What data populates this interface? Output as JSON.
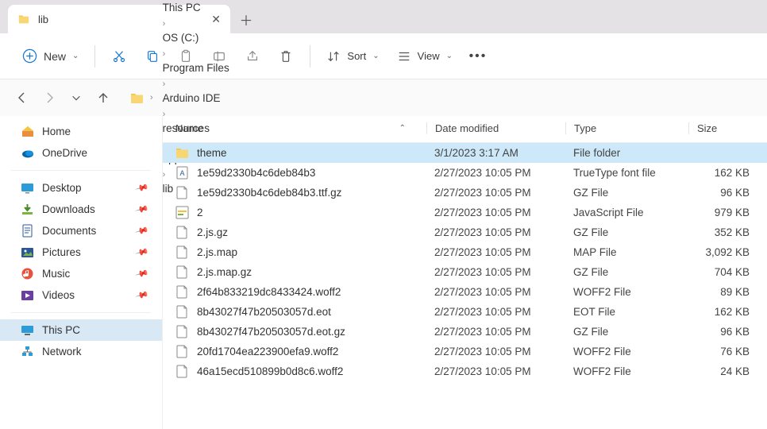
{
  "tab": {
    "title": "lib"
  },
  "toolbar": {
    "new": "New",
    "sort": "Sort",
    "view": "View"
  },
  "breadcrumb": [
    "This PC",
    "OS (C:)",
    "Program Files",
    "Arduino IDE",
    "resources",
    "app",
    "lib"
  ],
  "sidebar": {
    "quick": [
      {
        "label": "Home",
        "icon": "home"
      },
      {
        "label": "OneDrive",
        "icon": "onedrive"
      }
    ],
    "pinned": [
      {
        "label": "Desktop",
        "icon": "desktop"
      },
      {
        "label": "Downloads",
        "icon": "downloads"
      },
      {
        "label": "Documents",
        "icon": "documents"
      },
      {
        "label": "Pictures",
        "icon": "pictures"
      },
      {
        "label": "Music",
        "icon": "music"
      },
      {
        "label": "Videos",
        "icon": "videos"
      }
    ],
    "drives": [
      {
        "label": "This PC",
        "icon": "thispc",
        "selected": true
      },
      {
        "label": "Network",
        "icon": "network"
      }
    ]
  },
  "columns": {
    "name": "Name",
    "date": "Date modified",
    "type": "Type",
    "size": "Size"
  },
  "files": [
    {
      "name": "theme",
      "date": "3/1/2023 3:17 AM",
      "type": "File folder",
      "size": "",
      "icon": "folder",
      "selected": true
    },
    {
      "name": "1e59d2330b4c6deb84b3",
      "date": "2/27/2023 10:05 PM",
      "type": "TrueType font file",
      "size": "162 KB",
      "icon": "font"
    },
    {
      "name": "1e59d2330b4c6deb84b3.ttf.gz",
      "date": "2/27/2023 10:05 PM",
      "type": "GZ File",
      "size": "96 KB",
      "icon": "file"
    },
    {
      "name": "2",
      "date": "2/27/2023 10:05 PM",
      "type": "JavaScript File",
      "size": "979 KB",
      "icon": "js"
    },
    {
      "name": "2.js.gz",
      "date": "2/27/2023 10:05 PM",
      "type": "GZ File",
      "size": "352 KB",
      "icon": "file"
    },
    {
      "name": "2.js.map",
      "date": "2/27/2023 10:05 PM",
      "type": "MAP File",
      "size": "3,092 KB",
      "icon": "file"
    },
    {
      "name": "2.js.map.gz",
      "date": "2/27/2023 10:05 PM",
      "type": "GZ File",
      "size": "704 KB",
      "icon": "file"
    },
    {
      "name": "2f64b833219dc8433424.woff2",
      "date": "2/27/2023 10:05 PM",
      "type": "WOFF2 File",
      "size": "89 KB",
      "icon": "file"
    },
    {
      "name": "8b43027f47b20503057d.eot",
      "date": "2/27/2023 10:05 PM",
      "type": "EOT File",
      "size": "162 KB",
      "icon": "file"
    },
    {
      "name": "8b43027f47b20503057d.eot.gz",
      "date": "2/27/2023 10:05 PM",
      "type": "GZ File",
      "size": "96 KB",
      "icon": "file"
    },
    {
      "name": "20fd1704ea223900efa9.woff2",
      "date": "2/27/2023 10:05 PM",
      "type": "WOFF2 File",
      "size": "76 KB",
      "icon": "file"
    },
    {
      "name": "46a15ecd510899b0d8c6.woff2",
      "date": "2/27/2023 10:05 PM",
      "type": "WOFF2 File",
      "size": "24 KB",
      "icon": "file"
    }
  ]
}
